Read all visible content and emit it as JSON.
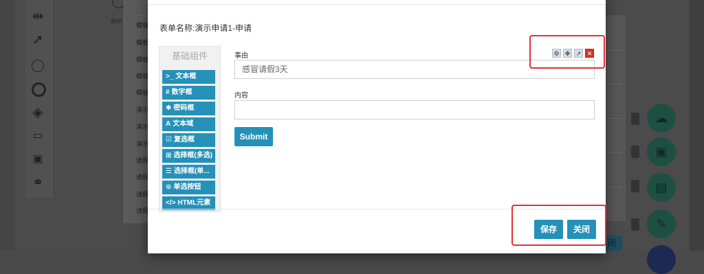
{
  "background": {
    "start_label": "启动",
    "list_rows": [
      "模板",
      "模板",
      "模板",
      "模板",
      "模板",
      "演示",
      "演示",
      "演示",
      "请假",
      "请假",
      "请假",
      "请假"
    ],
    "bottom_button_label": "闭",
    "tool_icons": [
      "split-horizontal-icon",
      "arrow-icon",
      "circle-event-icon",
      "end-event-icon",
      "gateway-icon",
      "user-task-icon",
      "service-task-icon",
      "link-icon"
    ],
    "fab_icons": [
      "cloud-upload-icon",
      "save-icon",
      "clipboard-icon",
      "edit-icon"
    ]
  },
  "modal": {
    "form_title": "表单名称:演示申请1-申请",
    "component_panel": {
      "header": "基础组件",
      "items": [
        {
          "icon": ">_",
          "label": "文本框"
        },
        {
          "icon": "#",
          "label": "数字框"
        },
        {
          "icon": "✱",
          "label": "密码框"
        },
        {
          "icon": "A",
          "label": "文本域"
        },
        {
          "icon": "☑",
          "label": "复选框"
        },
        {
          "icon": "⊞",
          "label": "选择框(多选)"
        },
        {
          "icon": "☰",
          "label": "选择框(单..."
        },
        {
          "icon": "⊙",
          "label": "单选按钮"
        },
        {
          "icon": "</>",
          "label": "HTML元素"
        }
      ]
    },
    "fields": [
      {
        "label": "事由",
        "value": "感冒请假3天"
      },
      {
        "label": "内容",
        "value": ""
      }
    ],
    "field_tools": [
      "gear-icon",
      "move-icon",
      "external-link-icon",
      "close-icon"
    ],
    "submit_label": "Submit",
    "save_label": "保存",
    "close_label": "关闭"
  },
  "colors": {
    "primary_button": "#2591b9",
    "highlight_box": "#e0303a"
  }
}
